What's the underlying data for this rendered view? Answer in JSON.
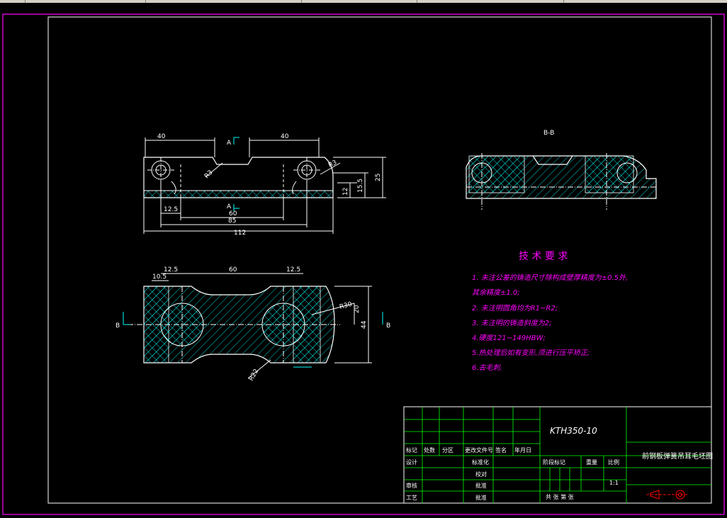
{
  "drawing": {
    "colors": {
      "background": "#000000",
      "outer_frame": "#ff00ff",
      "inner_frame": "#ffffff",
      "part_outline": "#ffffff",
      "hatch": "#00ffff",
      "tech_text": "#ff00ff",
      "title_grid": "#00ff00"
    },
    "top_view": {
      "dims": {
        "left_40": "40",
        "right_40": "40",
        "d12_5": "12.5",
        "d60": "60",
        "d85": "85",
        "d112": "112",
        "h12": "12",
        "h15_5": "15.5",
        "h25": "25",
        "r3": "R3",
        "r3b": "R3"
      },
      "section_a_top": "A",
      "section_a_bottom": "A"
    },
    "plan_view": {
      "dims": {
        "d10_5": "10.5",
        "d12_5_left": "12.5",
        "d60": "60",
        "d12_5_right": "12.5",
        "r30": "R30",
        "r22": "R22",
        "d20": "20",
        "d44": "44"
      },
      "section_b_left": "B",
      "section_b_right": "B"
    },
    "section_view": {
      "label": "B-B"
    },
    "tech_req": {
      "title": "技 术 要 求",
      "lines": [
        "1. 未注公差的铸造尺寸除构成壁厚精度为±0.5外,",
        "其余精度±1.0;",
        "2. 未注明圆角均为R1~R2;",
        "3. 未注明的铸造斜度为2;",
        "4.硬度121~149HBW;",
        "5.热处理后如有变形,须进行压平矫正;",
        "6.去毛刺."
      ]
    },
    "title_block": {
      "drawing_no": "KTH350-10",
      "part_name": "前钢板弹簧吊耳毛坯图",
      "labels": {
        "mark": "标记",
        "count": "处数",
        "zone": "分区",
        "change_doc": "更改文件号",
        "sign": "签名",
        "date": "年月日",
        "design": "设计",
        "standardize": "标准化",
        "check": "审核",
        "process": "工艺",
        "review": "校对",
        "approve": "批准",
        "stage_mark": "阶段标记",
        "weight": "重量",
        "scale": "比例",
        "scale_value": "1:1",
        "sheets": "共   张  第   张"
      }
    }
  }
}
